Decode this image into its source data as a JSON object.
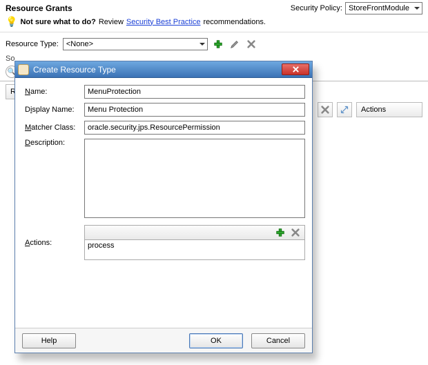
{
  "header": {
    "title": "Resource Grants",
    "security_policy_label": "Security Policy:",
    "security_policy_value": "StoreFrontModule"
  },
  "hint": {
    "bold": "Not sure what to do?",
    "pre": " Review ",
    "link": "Security Best Practice",
    "post": " recommendations."
  },
  "resource_type": {
    "label": "Resource Type:",
    "value": "<None>"
  },
  "strip": {
    "prefix": "So"
  },
  "table": {
    "col_r": "R",
    "col_actions": "Actions"
  },
  "dialog": {
    "title": "Create Resource Type",
    "fields": {
      "name_label": "Name:",
      "name_value": "MenuProtection",
      "display_name_label": "Display Name:",
      "display_name_value": "Menu Protection",
      "matcher_label": "Matcher Class:",
      "matcher_value": "oracle.security.jps.ResourcePermission",
      "description_label": "Description:",
      "description_value": "",
      "actions_label": "Actions:",
      "actions_content": "process"
    },
    "buttons": {
      "help": "Help",
      "ok": "OK",
      "cancel": "Cancel"
    }
  },
  "icons": {
    "add": "add-icon",
    "edit": "pencil-icon",
    "delete": "x-icon",
    "expand": "expand-icon",
    "close": "close-icon",
    "bulb": "lightbulb-icon"
  }
}
